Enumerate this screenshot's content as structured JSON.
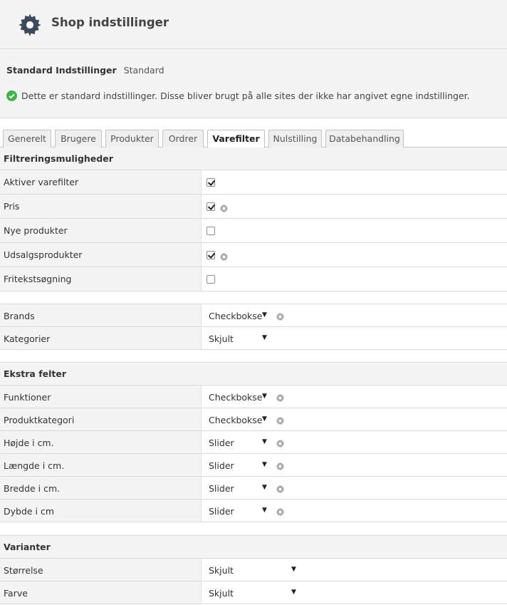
{
  "header": {
    "title": "Shop indstillinger",
    "icon": "gear-icon"
  },
  "info": {
    "label": "Standard Indstillinger",
    "value": "Standard",
    "message": "Dette er standard indstillinger. Disse bliver brugt på alle sites der ikke har angivet egne indstillinger.",
    "status_color": "#3db34a"
  },
  "tabs": [
    {
      "label": "Generelt"
    },
    {
      "label": "Brugere"
    },
    {
      "label": "Produkter"
    },
    {
      "label": "Ordrer"
    },
    {
      "label": "Varefilter"
    },
    {
      "label": "Nulstilling"
    },
    {
      "label": "Databehandling"
    }
  ],
  "active_tab": "Varefilter",
  "sections": {
    "filter": {
      "title": "Filtreringsmuligheder",
      "rows": [
        {
          "label": "Aktiver varefilter",
          "checked": true,
          "settings": false
        },
        {
          "label": "Pris",
          "checked": true,
          "settings": true
        },
        {
          "label": "Nye produkter",
          "checked": false,
          "settings": false
        },
        {
          "label": "Udsalgsprodukter",
          "checked": true,
          "settings": true
        },
        {
          "label": "Fritekstsøgning",
          "checked": false,
          "settings": false
        }
      ]
    },
    "basic": {
      "rows": [
        {
          "label": "Brands",
          "value": "Checkbokse",
          "settings": true
        },
        {
          "label": "Kategorier",
          "value": "Skjult",
          "settings": false
        }
      ]
    },
    "extra": {
      "title": "Ekstra felter",
      "rows": [
        {
          "label": "Funktioner",
          "value": "Checkbokse",
          "settings": true
        },
        {
          "label": "Produktkategori",
          "value": "Checkbokse",
          "settings": true
        },
        {
          "label": "Højde i cm.",
          "value": "Slider",
          "settings": true
        },
        {
          "label": "Længde i cm.",
          "value": "Slider",
          "settings": true
        },
        {
          "label": "Bredde i cm.",
          "value": "Slider",
          "settings": true
        },
        {
          "label": "Dybde i cm",
          "value": "Slider",
          "settings": true
        }
      ]
    },
    "variants": {
      "title": "Varianter",
      "rows": [
        {
          "label": "Størrelse",
          "value": "Skjult"
        },
        {
          "label": "Farve",
          "value": "Skjult"
        }
      ]
    }
  }
}
